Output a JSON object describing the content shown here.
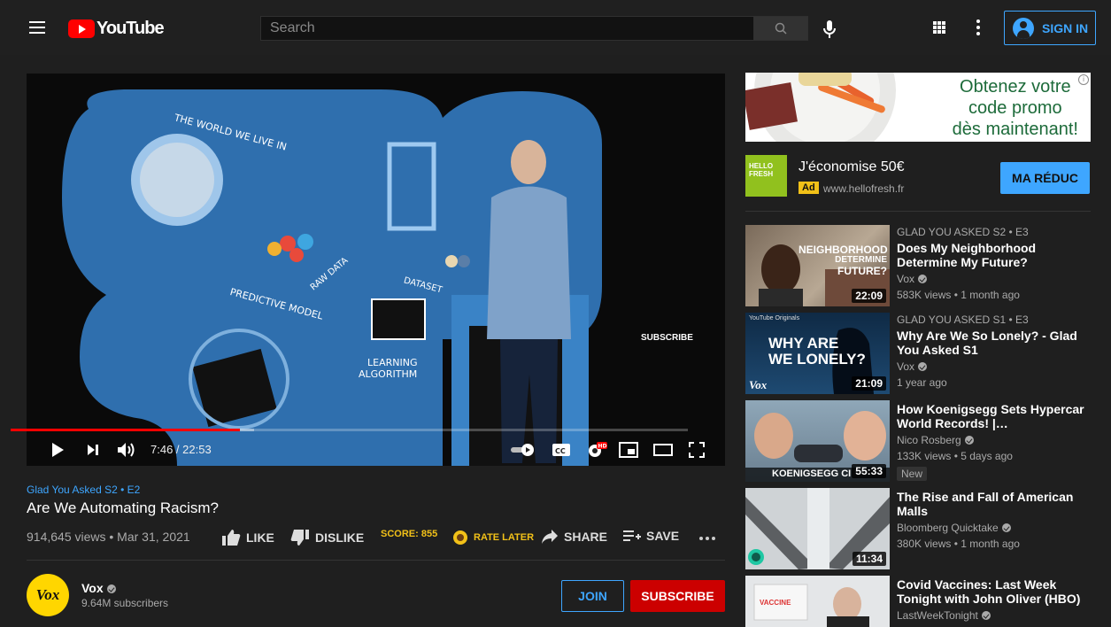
{
  "header": {
    "logo_text": "YouTube",
    "search_placeholder": "Search",
    "signin_label": "SIGN IN"
  },
  "player": {
    "time": "7:46 / 22:53",
    "progress_played": 0.339,
    "progress_loaded": 0.36,
    "watermark": "SUBSCRIBE",
    "scene_texts": [
      "THE WORLD WE LIVE IN",
      "RAW DATA",
      "DATASET",
      "PREDICTIVE MODEL",
      "LEARNING ALGORITHM"
    ]
  },
  "video": {
    "series": "Glad You Asked  S2 • E2",
    "title": "Are We Automating Racism?",
    "meta": "914,645 views • Mar 31, 2021",
    "like": "LIKE",
    "dislike": "DISLIKE",
    "score": "SCORE: 855",
    "rate_later": "RATE LATER",
    "share": "SHARE",
    "save": "SAVE"
  },
  "channel": {
    "avatar_text": "Vox",
    "name": "Vox",
    "subscribers": "9.64M subscribers",
    "join": "JOIN",
    "subscribe": "SUBSCRIBE"
  },
  "ad": {
    "banner_line1": "Obtenez votre",
    "banner_line2": "code promo",
    "banner_line3": "dès maintenant!",
    "logo_line1": "HELLO",
    "logo_line2": "FRESH",
    "title": "J'économise 50€",
    "tag": "Ad",
    "url": "www.hellofresh.fr",
    "cta": "MA RÉDUC"
  },
  "recommendations": [
    {
      "series": "GLAD YOU ASKED  S2 • E3",
      "title": "Does My Neighborhood Determine My Future?",
      "channel": "Vox",
      "meta": "583K views • 1 month ago",
      "duration": "22:09",
      "thumb_text": [
        "NEIGHBORHOOD",
        "DETERMINE",
        "FUTURE?"
      ]
    },
    {
      "series": "GLAD YOU ASKED  S1 • E3",
      "title": "Why Are We So Lonely? - Glad You Asked S1",
      "channel": "Vox",
      "meta": "1 year ago",
      "duration": "21:09",
      "thumb_text": [
        "YouTube Originals",
        "WHY ARE",
        "WE LONELY?",
        "Vox"
      ]
    },
    {
      "title": "How Koenigsegg Sets Hypercar World Records! |…",
      "channel": "Nico Rosberg",
      "meta": "133K views • 5 days ago",
      "badge": "New",
      "duration": "55:33",
      "thumb_text": [
        "KOENIGSEGG CI"
      ]
    },
    {
      "title": "The Rise and Fall of American Malls",
      "channel": "Bloomberg Quicktake",
      "meta": "380K views • 1 month ago",
      "duration": "11:34"
    },
    {
      "title": "Covid Vaccines: Last Week Tonight with John Oliver (HBO)",
      "channel": "LastWeekTonight",
      "thumb_text": [
        "VACCINE"
      ]
    }
  ]
}
